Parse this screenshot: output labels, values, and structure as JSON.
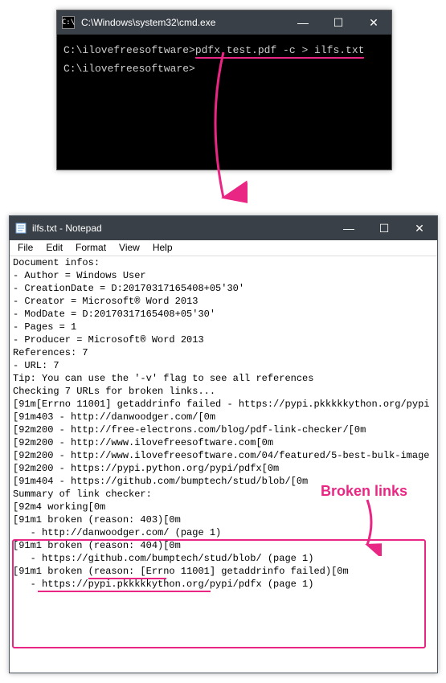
{
  "cmd": {
    "title": "C:\\Windows\\system32\\cmd.exe",
    "icon_label": "C:\\",
    "lines": {
      "prompt1_prefix": "C:\\ilovefreesoftware>",
      "prompt1_command": "pdfx test.pdf -c > ilfs.txt",
      "prompt2": "C:\\ilovefreesoftware>"
    }
  },
  "notepad": {
    "title": "ilfs.txt - Notepad",
    "menu": {
      "file": "File",
      "edit": "Edit",
      "format": "Format",
      "view": "View",
      "help": "Help"
    },
    "content": [
      "Document infos:",
      "- Author = Windows User",
      "- CreationDate = D:20170317165408+05'30'",
      "- Creator = Microsoft® Word 2013",
      "- ModDate = D:20170317165408+05'30'",
      "- Pages = 1",
      "- Producer = Microsoft® Word 2013",
      "",
      "References: 7",
      "- URL: 7",
      "",
      "Tip: You can use the '-v' flag to see all references",
      "",
      "Checking 7 URLs for broken links...",
      "\u001b[91m[Errno 11001] getaddrinfo failed - https://pypi.pkkkkkython.org/pypi",
      "\u001b[91m403 - http://danwoodger.com/\u001b[0m",
      "\u001b[92m200 - http://free-electrons.com/blog/pdf-link-checker/\u001b[0m",
      "\u001b[92m200 - http://www.ilovefreesoftware.com\u001b[0m",
      "\u001b[92m200 - http://www.ilovefreesoftware.com/04/featured/5-best-bulk-image",
      "\u001b[92m200 - https://pypi.python.org/pypi/pdfx\u001b[0m",
      "\u001b[91m404 - https://github.com/bumptech/stud/blob/\u001b[0m",
      "",
      "Summary of link checker:",
      "\u001b[92m4 working\u001b[0m",
      "\u001b[91m1 broken (reason: 403)\u001b[0m",
      "   - http://danwoodger.com/ (page 1)",
      "\u001b[91m1 broken (reason: 404)\u001b[0m",
      "   - https://github.com/bumptech/stud/blob/ (page 1)",
      "\u001b[91m1 broken (reason: [Errno 11001] getaddrinfo failed)\u001b[0m",
      "   - https://pypi.pkkkkkython.org/pypi/pdfx (page 1)",
      ""
    ]
  },
  "annotations": {
    "broken_links_label": "Broken links"
  },
  "win_controls": {
    "minimize": "—",
    "maximize": "☐",
    "close": "✕"
  }
}
